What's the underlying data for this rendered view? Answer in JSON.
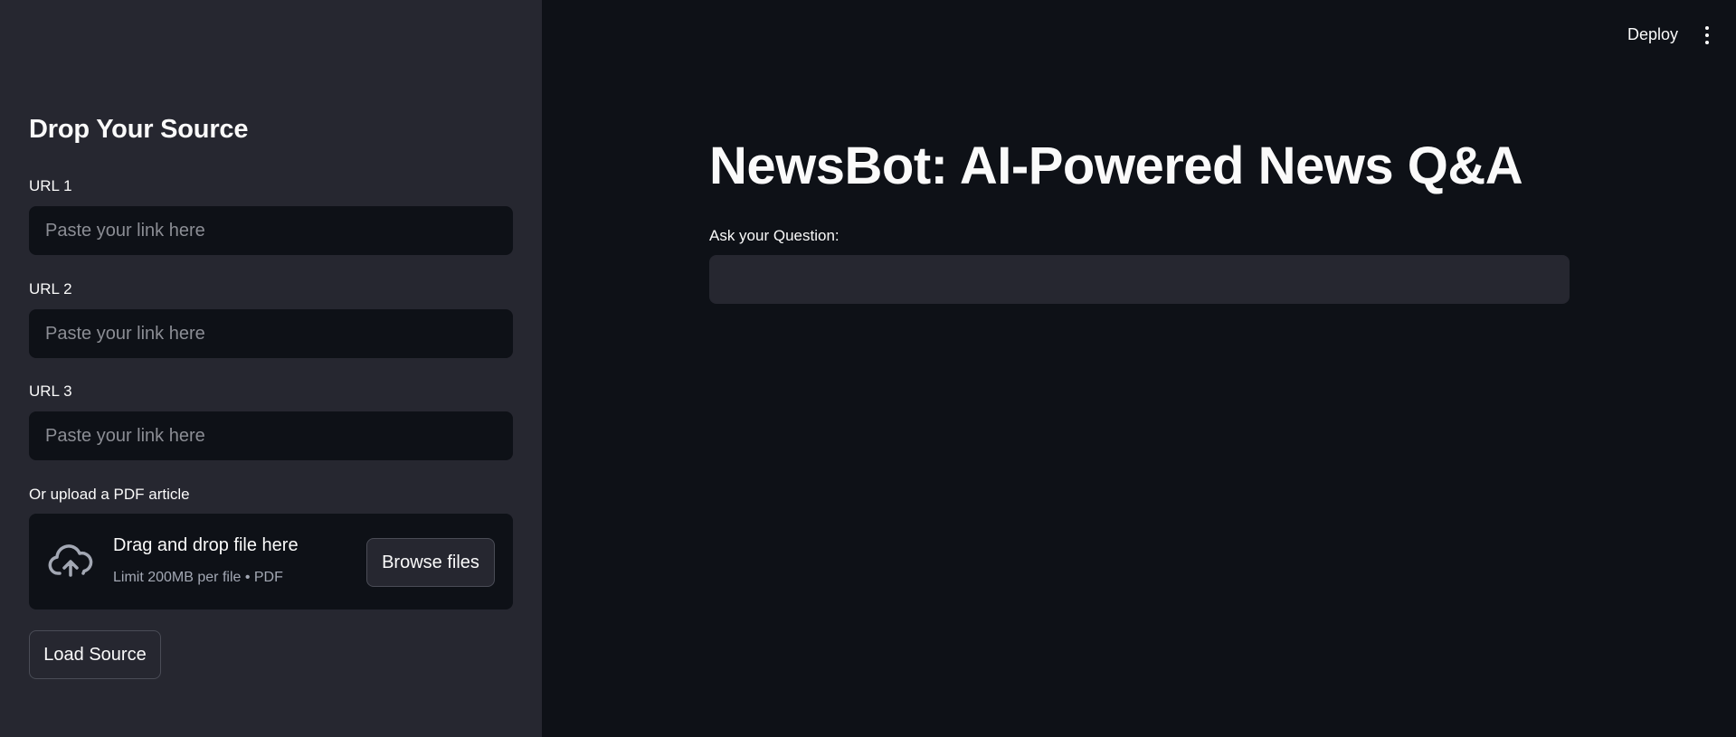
{
  "colors": {
    "sidebar_bg": "#262730",
    "main_bg": "#0e1117",
    "input_bg": "#0e1117",
    "text": "#fafafa",
    "muted_text": "#a3a8b4"
  },
  "sidebar": {
    "header": "Drop Your Source",
    "url_fields": [
      {
        "label": "URL 1",
        "placeholder": "Paste your link here",
        "value": ""
      },
      {
        "label": "URL 2",
        "placeholder": "Paste your link here",
        "value": ""
      },
      {
        "label": "URL 3",
        "placeholder": "Paste your link here",
        "value": ""
      }
    ],
    "uploader": {
      "label": "Or upload a PDF article",
      "icon": "cloud-upload-icon",
      "title": "Drag and drop file here",
      "subtitle": "Limit 200MB per file • PDF",
      "browse_label": "Browse files"
    },
    "load_button_label": "Load Source"
  },
  "topbar": {
    "deploy_label": "Deploy",
    "menu_icon": "kebab-menu-icon"
  },
  "main": {
    "title": "NewsBot: AI-Powered News Q&A",
    "question_label": "Ask your Question:",
    "question_value": ""
  }
}
